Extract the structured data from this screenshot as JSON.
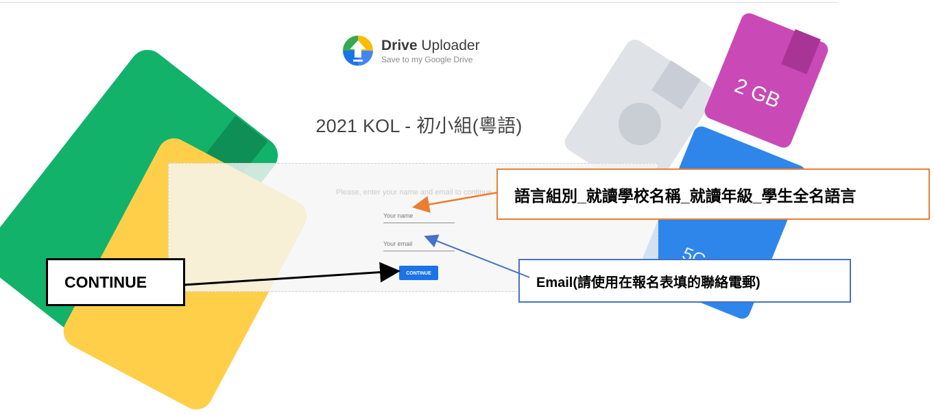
{
  "brand": {
    "name_bold": "Drive",
    "name_rest": " Uploader",
    "tagline": "Save to my Google Drive"
  },
  "page": {
    "title": "2021 KOL - 初小組(粵語)"
  },
  "form": {
    "instructions": "Please, enter your name and email to continue",
    "name_placeholder": "Your name",
    "email_placeholder": "Your email",
    "continue_label": "CONTINUE"
  },
  "annotations": {
    "name_hint": "語言組別_就讀學校名稱_就讀年級_學生全名語言",
    "email_hint": "Email(請使用在報名表填的聯絡電郵)",
    "continue_hint": "CONTINUE"
  },
  "decor": {
    "storage_label": "2 GB",
    "blue_label": "5G"
  },
  "colors": {
    "accent_blue": "#1a73e8",
    "callout_orange": "#ed7d31",
    "callout_blue": "#4472c4",
    "green": "#12b26b",
    "yellow": "#ffcf4a",
    "magenta": "#c94ab6"
  }
}
